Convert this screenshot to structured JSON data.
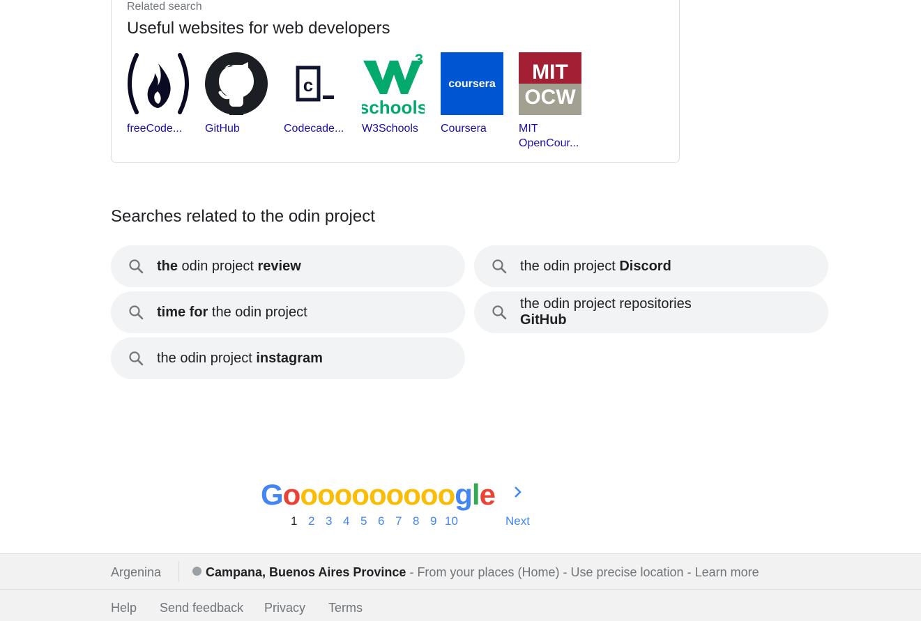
{
  "related_card": {
    "kicker": "Related search",
    "title": "Useful websites for web developers",
    "sites": [
      {
        "name": "freeCode...",
        "logo": "freecodecamp-logo"
      },
      {
        "name": "GitHub",
        "logo": "github-logo"
      },
      {
        "name": "Codecade...",
        "logo": "codecademy-logo"
      },
      {
        "name": "W3Schools",
        "logo": "w3schools-logo"
      },
      {
        "name": "Coursera",
        "logo": "coursera-logo",
        "logo_text": "coursera"
      },
      {
        "name": "MIT\nOpenCour...",
        "logo": "mit-ocw-logo",
        "logo_text_top": "MIT",
        "logo_text_bottom": "OCW"
      }
    ]
  },
  "related_searches": {
    "title": "Searches related to the odin project",
    "chips": [
      {
        "parts": [
          [
            "the",
            true
          ],
          [
            " odin project ",
            false
          ],
          [
            "review",
            true
          ]
        ]
      },
      {
        "parts": [
          [
            "the odin project ",
            false
          ],
          [
            "Discord",
            true
          ]
        ]
      },
      {
        "parts": [
          [
            "time for",
            true
          ],
          [
            " the odin project",
            false
          ]
        ]
      },
      {
        "parts": [
          [
            "the odin project repositories",
            false
          ],
          [
            "GitHub",
            true
          ]
        ],
        "two_line": true
      },
      {
        "parts": [
          [
            "the odin project ",
            false
          ],
          [
            "instagram",
            true
          ]
        ]
      }
    ]
  },
  "pagination": {
    "logo_letters": [
      "G",
      "o",
      "o",
      "o",
      "o",
      "o",
      "o",
      "o",
      "o",
      "o",
      "o",
      "g",
      "l",
      "e"
    ],
    "logo_colors": [
      "#4285f4",
      "#ea4335",
      "#fbbc05",
      "#fbbc05",
      "#fbbc05",
      "#fbbc05",
      "#fbbc05",
      "#fbbc05",
      "#fbbc05",
      "#fbbc05",
      "#fbbc05",
      "#4285f4",
      "#34a853",
      "#ea4335"
    ],
    "pages": [
      "1",
      "2",
      "3",
      "4",
      "5",
      "6",
      "7",
      "8",
      "9",
      "10"
    ],
    "current": "1",
    "next_label": "Next"
  },
  "footer": {
    "country": "Argenina",
    "location": "Campana, Buenos Aires Province",
    "sep": " - ",
    "from_places": "From your places (Home)",
    "precise": "Use precise location",
    "learn_more": "Learn more",
    "links": [
      "Help",
      "Send feedback",
      "Privacy",
      "Terms"
    ]
  },
  "colors": {
    "link": "#1a0dab",
    "chip_bg": "#f1f3f4",
    "page_blue": "#4285f4",
    "coursera": "#0056d2",
    "mit_red": "#a31f34",
    "w3_green": "#04aa6d"
  }
}
